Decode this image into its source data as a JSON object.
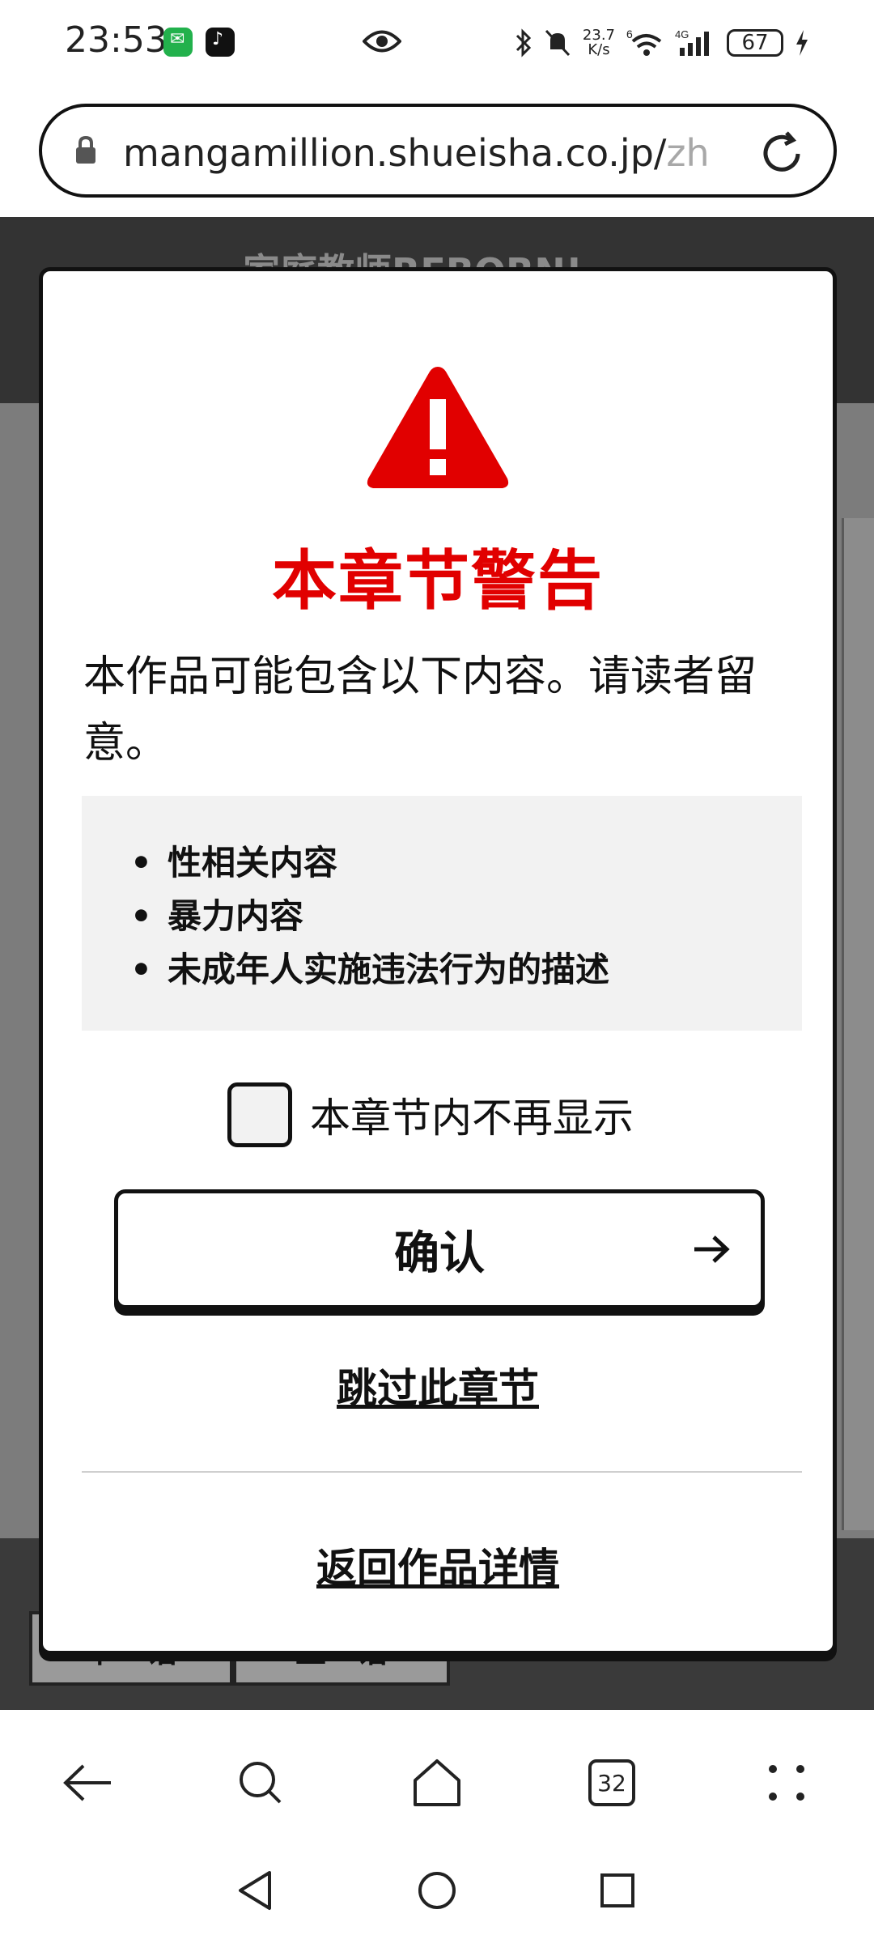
{
  "status_bar": {
    "time": "23:53",
    "net_speed_top": "23.7",
    "net_speed_bottom": "K/s",
    "wifi_label": "6",
    "cell_label": "4G",
    "battery": "67",
    "icons": [
      "wechat-icon",
      "tiktok-icon",
      "eye-icon",
      "bluetooth-icon",
      "mute-icon",
      "wifi-icon",
      "signal-icon",
      "battery-icon",
      "charging-icon"
    ]
  },
  "address_bar": {
    "url_main": "mangamillion.shueisha.co.jp/",
    "url_fade": "zh"
  },
  "page": {
    "title": "家庭教师REBORN!",
    "footer_tabs": [
      "下一话",
      "上一话"
    ]
  },
  "modal": {
    "title": "本章节警告",
    "description": "本作品可能包含以下内容。请读者留意。",
    "items": [
      "性相关内容",
      "暴力内容",
      "未成年人实施违法行为的描述"
    ],
    "checkbox_label": "本章节内不再显示",
    "checkbox_checked": false,
    "confirm_label": "确认",
    "skip_label": "跳过此章节",
    "back_label": "返回作品详情",
    "accent_color": "#e10000"
  },
  "toolbar": {
    "tab_count": "32"
  }
}
